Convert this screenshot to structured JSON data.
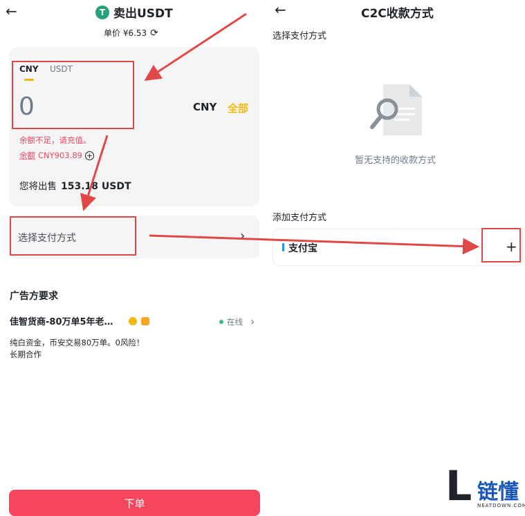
{
  "left": {
    "title": "卖出USDT",
    "tether_symbol": "T",
    "price": "单价 ¥6.53",
    "tabs": [
      "CNY",
      "USDT"
    ],
    "amount": "0",
    "currency": "CNY",
    "all_label": "全部",
    "warning": "余额不足，请充值。",
    "balance_label": "余额",
    "balance_value": "CNY903.89",
    "sell_prefix": "您将出售",
    "sell_amount": "153.18 USDT",
    "payment_label": "选择支付方式",
    "ad_requirements": "广告方要求",
    "merchant_name": "佳智货商-80万单5年老…",
    "online_label": "在线",
    "description_line1": "纯白资金，币安交易80万单。0风险！",
    "description_line2": "长期合作",
    "order_button": "下单"
  },
  "right": {
    "title": "C2C收款方式",
    "select_label": "选择支付方式",
    "empty_text": "暂无支持的收款方式",
    "add_label": "添加支付方式",
    "alipay_label": "支付宝"
  },
  "watermark": {
    "brand": "链懂",
    "sub": "NEATDOWN.COM",
    "letter": "L"
  },
  "colors": {
    "accent": "#f0b90b",
    "sell_button": "#f6465d",
    "warning": "#e84661",
    "annotation": "#e04848"
  }
}
